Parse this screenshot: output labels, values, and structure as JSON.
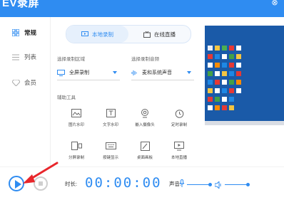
{
  "app": {
    "title": "EV录屏",
    "close_icon": "close-icon"
  },
  "sidebar": {
    "items": [
      {
        "label": "常规",
        "icon": "grid-icon",
        "active": true
      },
      {
        "label": "列表",
        "icon": "list-icon",
        "active": false
      },
      {
        "label": "会员",
        "icon": "diamond-icon",
        "active": false
      }
    ]
  },
  "main": {
    "tabs": [
      {
        "label": "本地录制",
        "icon": "monitor-record-icon",
        "active": true
      },
      {
        "label": "在线直播",
        "icon": "tv-live-icon",
        "active": false
      }
    ],
    "region": {
      "label": "选择录制区域",
      "value": "全屏录制"
    },
    "audio": {
      "label": "选择录制音频",
      "value": "麦和系统声音"
    },
    "tools_label": "辅助工具",
    "tools": [
      {
        "label": "图片水印",
        "icon": "image-watermark-icon"
      },
      {
        "label": "文字水印",
        "icon": "text-watermark-icon"
      },
      {
        "label": "嵌入摄像头",
        "icon": "webcam-icon"
      },
      {
        "label": "定时录制",
        "icon": "timer-icon"
      },
      {
        "label": "分屏录制",
        "icon": "split-screen-icon"
      },
      {
        "label": "按键显示",
        "icon": "keyboard-icon"
      },
      {
        "label": "桌面画板",
        "icon": "whiteboard-icon"
      },
      {
        "label": "本地直播",
        "icon": "local-live-icon"
      }
    ]
  },
  "preview": {
    "description_icon": "desktop-preview"
  },
  "bottom": {
    "duration_label": "时长:",
    "timer": "00:00:00",
    "volume_label": "声音:"
  },
  "colors": {
    "accent": "#2f8cf1",
    "annotation_arrow": "#e8262b"
  }
}
